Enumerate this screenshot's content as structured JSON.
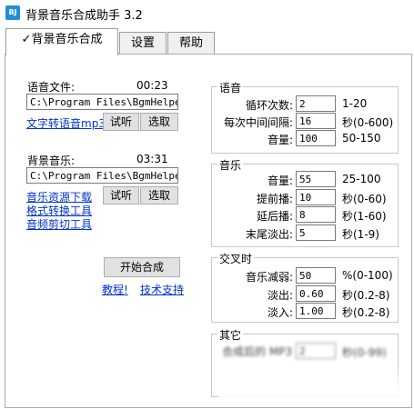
{
  "app": {
    "title": "背景音乐合成助手 3.2",
    "icon_text": "BJ"
  },
  "tabs": [
    {
      "label": "✓背景音乐合成"
    },
    {
      "label": "设置"
    },
    {
      "label": "帮助"
    }
  ],
  "voice_file": {
    "label": "语音文件:",
    "duration": "00:23",
    "path": "C:\\Program Files\\BgmHelper\\",
    "tts_link": "文字转语音mp3",
    "listen": "试听",
    "choose": "选取"
  },
  "bg_music": {
    "label": "背景音乐:",
    "duration": "03:31",
    "path": "C:\\Program Files\\BgmHelper\\",
    "links": [
      "音乐资源下载",
      "格式转换工具",
      "音频剪切工具"
    ],
    "listen": "试听",
    "choose": "选取"
  },
  "actions": {
    "start": "开始合成",
    "tutorial": "教程!",
    "support": "技术支持"
  },
  "voice_group": {
    "title": "语音",
    "rows": [
      {
        "label": "循环次数:",
        "value": "2",
        "range": "1-20"
      },
      {
        "label": "每次中间间隔:",
        "value": "16",
        "range": "秒(0-600)"
      },
      {
        "label": "音量:",
        "value": "100",
        "range": "50-150"
      }
    ]
  },
  "music_group": {
    "title": "音乐",
    "rows": [
      {
        "label": "音量:",
        "value": "55",
        "range": "25-100"
      },
      {
        "label": "提前播:",
        "value": "10",
        "range": "秒(0-60)"
      },
      {
        "label": "延后播:",
        "value": "8",
        "range": "秒(1-60)"
      },
      {
        "label": "末尾淡出:",
        "value": "5",
        "range": "秒(1-9)"
      }
    ]
  },
  "cross_group": {
    "title": "交叉时",
    "rows": [
      {
        "label": "音乐减弱:",
        "value": "50",
        "range": "%(0-100)"
      },
      {
        "label": "淡出:",
        "value": "0.60",
        "range": "秒(0.2-8)"
      },
      {
        "label": "淡入:",
        "value": "1.00",
        "range": "秒(0.2-8)"
      }
    ]
  },
  "other_group": {
    "title": "其它",
    "label": "合成后的 MP3",
    "value": "2",
    "range": "秒(0-99)"
  }
}
